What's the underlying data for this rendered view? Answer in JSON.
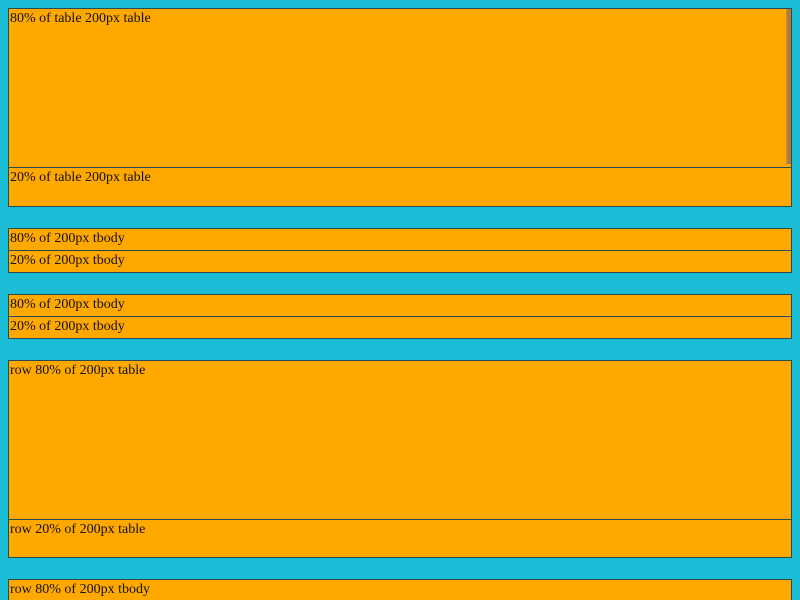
{
  "tables": [
    {
      "rows": [
        {
          "label": "80% of table 200px table"
        },
        {
          "label": "20% of table 200px table"
        }
      ]
    },
    {
      "rows": [
        {
          "label": "80% of 200px tbody"
        },
        {
          "label": "20% of 200px tbody"
        }
      ]
    },
    {
      "rows": [
        {
          "label": "80% of 200px tbody"
        },
        {
          "label": "20% of 200px tbody"
        }
      ]
    },
    {
      "rows": [
        {
          "label": "row 80% of 200px table"
        },
        {
          "label": "row 20% of 200px table"
        }
      ]
    },
    {
      "rows": [
        {
          "label": "row 80% of 200px tbody"
        }
      ]
    }
  ],
  "colors": {
    "page_background": "#1bbdd6",
    "cell_background": "#ffa800",
    "border": "#2a4a50"
  }
}
